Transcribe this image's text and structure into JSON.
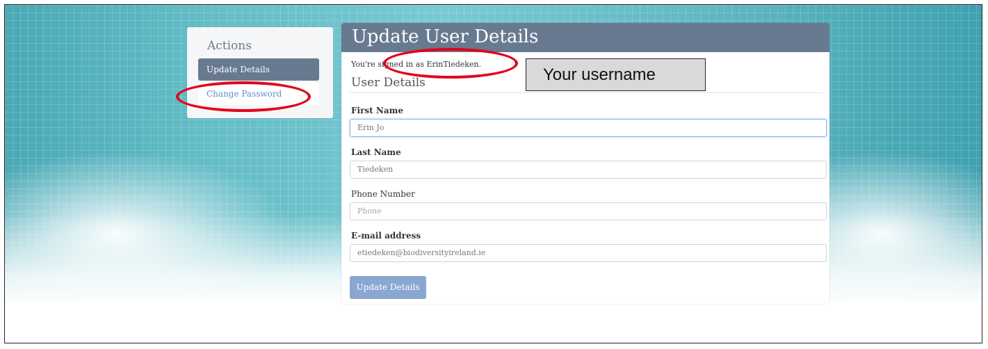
{
  "sidebar": {
    "title": "Actions",
    "items": [
      {
        "label": "Update Details"
      },
      {
        "label": "Change Password"
      }
    ]
  },
  "main": {
    "title": "Update User Details",
    "signed_in_prefix": "You're signed in as",
    "username": "ErinTiedeken",
    "signed_in_suffix": ".",
    "section_title": "User Details",
    "fields": {
      "first_name": {
        "label": "First Name",
        "value": "Erin Jo"
      },
      "last_name": {
        "label": "Last Name",
        "value": "Tiedeken"
      },
      "phone": {
        "label": "Phone Number",
        "placeholder": "Phone"
      },
      "email": {
        "label": "E-mail address",
        "value": "etiedeken@biodiversityireland.ie"
      }
    },
    "submit_label": "Update Details"
  },
  "annotation": {
    "callout_text": "Your username",
    "highlight_color": "#e3001b"
  },
  "colors": {
    "header": "#687a8f",
    "active_nav": "#687a8f",
    "link": "#5b8fc7",
    "button": "#8aa7d1"
  }
}
